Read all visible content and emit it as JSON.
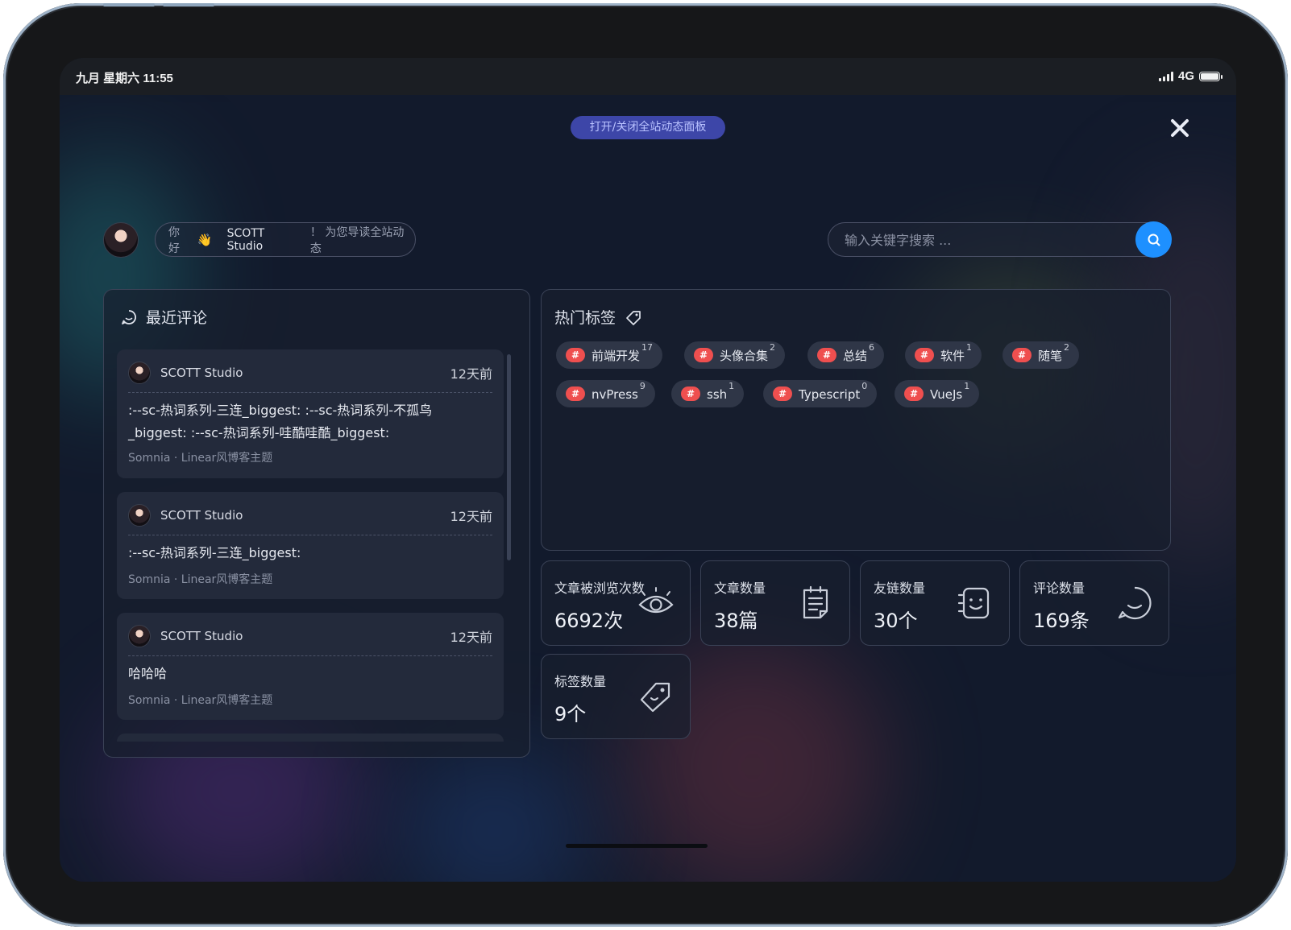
{
  "status_bar": {
    "time": "九月 星期六 11:55",
    "network": "4G",
    "battery": 1.0
  },
  "top": {
    "toggle_label": "打开/关闭全站动态面板"
  },
  "greeting": {
    "hello": "你好",
    "wave": "👋",
    "name": "SCOTT Studio",
    "tail": "！ 为您导读全站动态"
  },
  "search": {
    "placeholder": "输入关键字搜索 ..."
  },
  "comments": {
    "title": "最近评论",
    "items": [
      {
        "author": "SCOTT Studio",
        "time": "12天前",
        "body": ":--sc-热词系列-三连_biggest: :--sc-热词系列-不孤鸟_biggest: :--sc-热词系列-哇酷哇酷_biggest:",
        "meta": "Somnia · Linear风博客主题"
      },
      {
        "author": "SCOTT Studio",
        "time": "12天前",
        "body": ":--sc-热词系列-三连_biggest:",
        "meta": "Somnia · Linear风博客主题"
      },
      {
        "author": "SCOTT Studio",
        "time": "12天前",
        "body": "哈哈哈",
        "meta": "Somnia · Linear风博客主题"
      }
    ]
  },
  "tags": {
    "title": "热门标签",
    "hash_symbol": "#",
    "items": [
      {
        "name": "前端开发",
        "count": "17"
      },
      {
        "name": "头像合集",
        "count": "2"
      },
      {
        "name": "总结",
        "count": "6"
      },
      {
        "name": "软件",
        "count": "1"
      },
      {
        "name": "随笔",
        "count": "2"
      },
      {
        "name": "nvPress",
        "count": "9"
      },
      {
        "name": "ssh",
        "count": "1"
      },
      {
        "name": "Typescript",
        "count": "0"
      },
      {
        "name": "VueJs",
        "count": "1"
      }
    ]
  },
  "stats": [
    {
      "label": "文章被浏览次数",
      "value": "6692次",
      "icon": "eye-icon"
    },
    {
      "label": "文章数量",
      "value": "38篇",
      "icon": "document-icon"
    },
    {
      "label": "友链数量",
      "value": "30个",
      "icon": "face-scan-icon"
    },
    {
      "label": "评论数量",
      "value": "169条",
      "icon": "chat-bubble-icon"
    },
    {
      "label": "标签数量",
      "value": "9个",
      "icon": "tag-icon"
    }
  ],
  "colors": {
    "accent": "#1e90ff",
    "tag_hash": "#ef4f4f",
    "toggle_pill": "#3d46a8"
  }
}
